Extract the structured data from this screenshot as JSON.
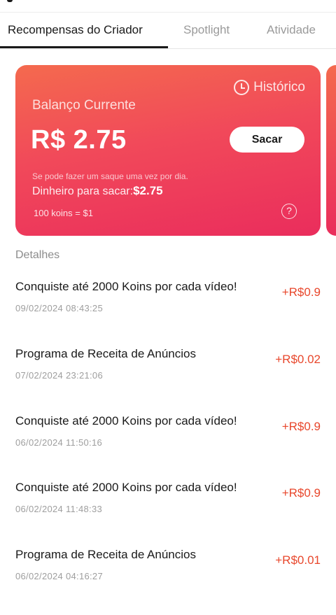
{
  "tabs": [
    {
      "label": "Recompensas do Criador",
      "active": true
    },
    {
      "label": "Spotlight",
      "active": false
    },
    {
      "label": "Atividade",
      "active": false
    }
  ],
  "card": {
    "history_label": "Histórico",
    "history_icon": "clock-icon",
    "balance_label": "Balanço Currente",
    "balance_amount": "R$ 2.75",
    "withdraw_button": "Sacar",
    "note": "Se pode fazer um saque uma vez por dia.",
    "withdrawable_label": "Dinheiro para sacar:",
    "withdrawable_value": "$2.75",
    "rate": "100 koins = $1",
    "help_icon": "question-circle-icon",
    "gradient_start": "#f46a4e",
    "gradient_end": "#ea2d5c"
  },
  "details": {
    "title": "Detalhes",
    "amount_color": "#e8472c",
    "items": [
      {
        "title": "Conquiste até 2000 Koins por cada vídeo!",
        "time": "09/02/2024 08:43:25",
        "amount": "+R$0.9"
      },
      {
        "title": "Programa de Receita de Anúncios",
        "time": "07/02/2024 23:21:06",
        "amount": "+R$0.02"
      },
      {
        "title": "Conquiste até 2000 Koins por cada vídeo!",
        "time": "06/02/2024 11:50:16",
        "amount": "+R$0.9"
      },
      {
        "title": "Conquiste até 2000 Koins por cada vídeo!",
        "time": "06/02/2024 11:48:33",
        "amount": "+R$0.9"
      },
      {
        "title": "Programa de Receita de Anúncios",
        "time": "06/02/2024 04:16:27",
        "amount": "+R$0.01"
      }
    ]
  }
}
